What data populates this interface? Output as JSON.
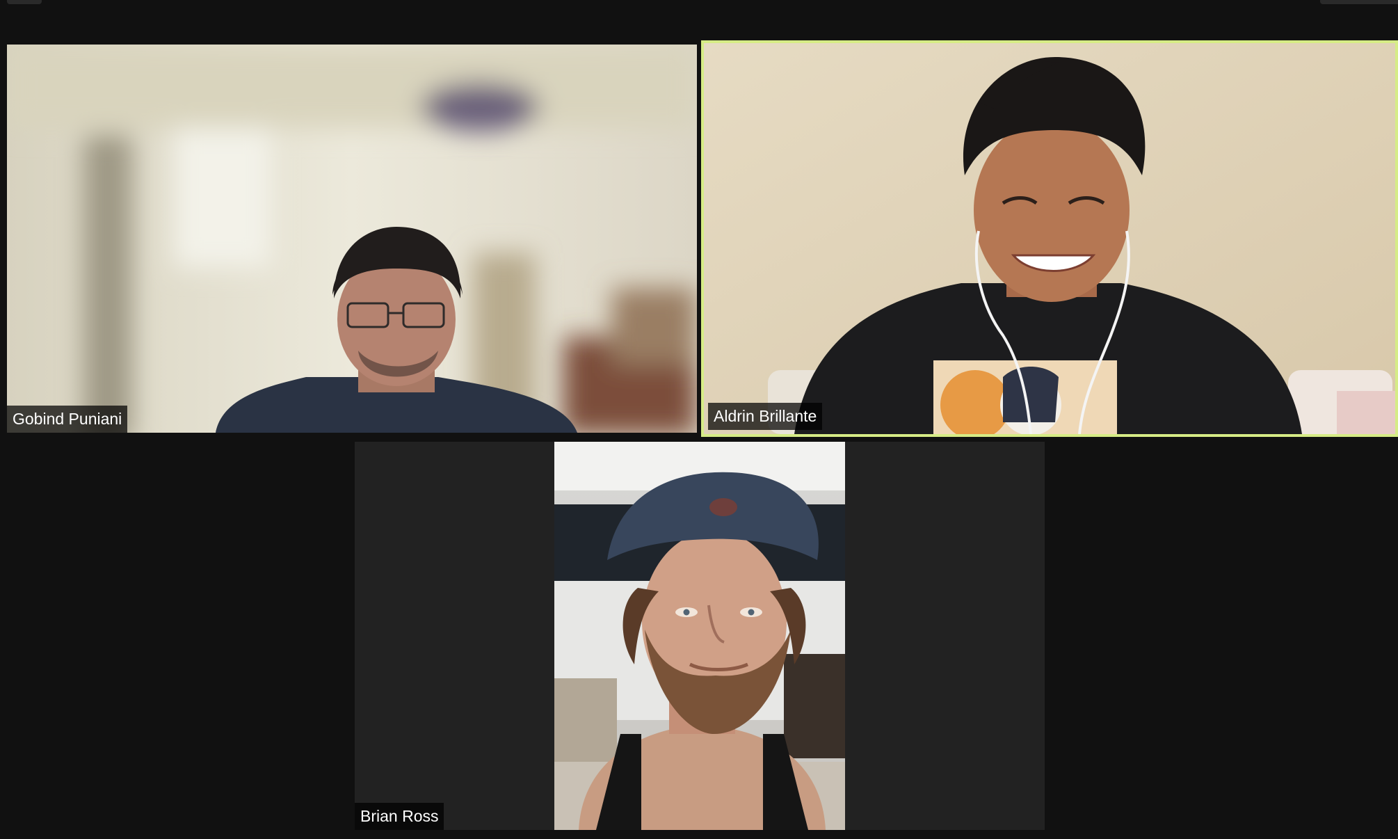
{
  "meeting": {
    "participants": [
      {
        "name": "Gobind Puniani",
        "active_speaker": false
      },
      {
        "name": "Aldrin Brillante",
        "active_speaker": true
      },
      {
        "name": "Brian Ross",
        "active_speaker": false
      }
    ]
  },
  "colors": {
    "background": "#111111",
    "tile_background": "#222222",
    "active_speaker_border": "#d6ec86",
    "label_text": "#ffffff"
  }
}
